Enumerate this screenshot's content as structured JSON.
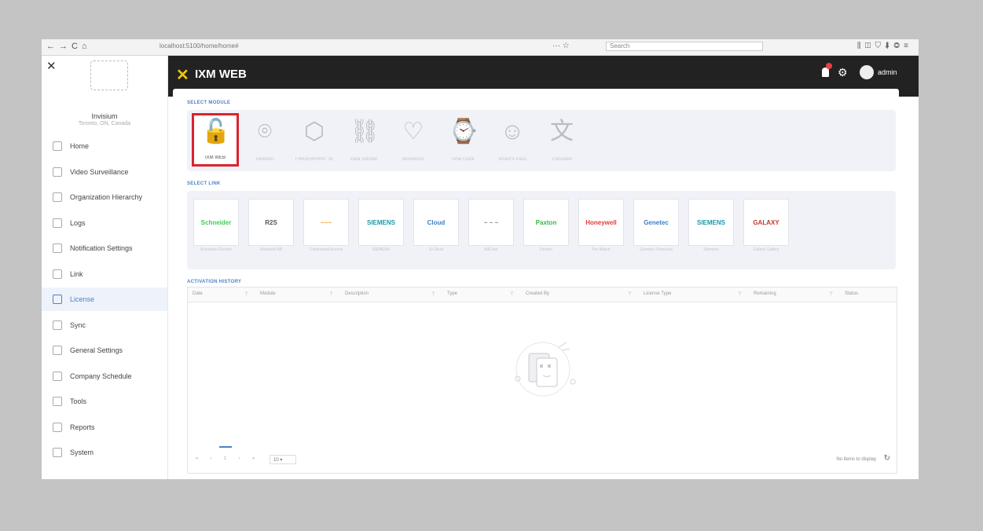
{
  "browser": {
    "url": "localhost:5100/home/home#",
    "search_placeholder": "Search",
    "nav_glyphs": "←→C⌂",
    "right_glyphs": "⫼◫⛉⬇◎≡",
    "page_actions": "··· ☆"
  },
  "sidebar": {
    "close_glyph": "✕",
    "org_name": "Invisium",
    "org_location": "Toronto, ON, Canada",
    "items": [
      {
        "label": "Home"
      },
      {
        "label": "Video Surveillance"
      },
      {
        "label": "Organization Hierarchy"
      },
      {
        "label": "Logs"
      },
      {
        "label": "Notification Settings"
      },
      {
        "label": "Link"
      },
      {
        "label": "License"
      },
      {
        "label": "Sync"
      },
      {
        "label": "General Settings"
      },
      {
        "label": "Company Schedule"
      },
      {
        "label": "Tools"
      },
      {
        "label": "Reports"
      },
      {
        "label": "System"
      }
    ],
    "active_index": 6
  },
  "header": {
    "brand": "IXM WEB",
    "brand_icon": "✕",
    "gear_glyph": "⚙",
    "user": "admin"
  },
  "select_module": {
    "title": "SELECT MODULE",
    "modules": [
      {
        "label": "IXM WEB",
        "glyph": "🔓",
        "selected": true
      },
      {
        "label": "TimeNAT",
        "glyph": "⌾"
      },
      {
        "label": "FINGERPRINT ID",
        "glyph": "⬡"
      },
      {
        "label": "Data Stitcher",
        "glyph": "⛓"
      },
      {
        "label": "Biometrics",
        "glyph": "♡"
      },
      {
        "label": "Time Clock",
        "glyph": "⌚"
      },
      {
        "label": "Visitor's Pass",
        "glyph": "☺"
      },
      {
        "label": "Translator",
        "glyph": "文"
      }
    ]
  },
  "select_link": {
    "title": "SELECT LINK",
    "links": [
      {
        "label": "Schneider Electric",
        "logo": "Schneider",
        "color": "#3dcd58"
      },
      {
        "label": "Rockwell AB",
        "logo": "R2S",
        "color": "#555555"
      },
      {
        "label": "Continental Access",
        "logo": "~~~",
        "color": "#f0a030"
      },
      {
        "label": "SIEMENS",
        "logo": "SIEMENS",
        "color": "#1a9aa8"
      },
      {
        "label": "S-Cloud",
        "logo": "Cloud",
        "color": "#3c7fc4"
      },
      {
        "label": "BACnet",
        "logo": "~ ~ ~",
        "color": "#888888"
      },
      {
        "label": "Paxton",
        "logo": "Paxton",
        "color": "#3ab54a"
      },
      {
        "label": "Pro-Watch",
        "logo": "Honeywell",
        "color": "#e03b3b"
      },
      {
        "label": "Genetec Omnicast",
        "logo": "Genetec",
        "color": "#3c7fc4"
      },
      {
        "label": "Siemens",
        "logo": "SIEMENS",
        "color": "#1a9aa8"
      },
      {
        "label": "Galaxy Gallery",
        "logo": "GALAXY",
        "color": "#c0392b"
      }
    ]
  },
  "activation_history": {
    "title": "ACTIVATION HISTORY",
    "columns": [
      "Date",
      "Module",
      "Description",
      "Type",
      "Created By",
      "License Type",
      "Remaining",
      "Status"
    ],
    "empty_text": "No items to display",
    "page_size": "10",
    "pager_glyphs": [
      "«",
      "‹",
      "1",
      "›",
      "»"
    ],
    "refresh_glyph": "↻",
    "filter_glyph": "⊤"
  }
}
